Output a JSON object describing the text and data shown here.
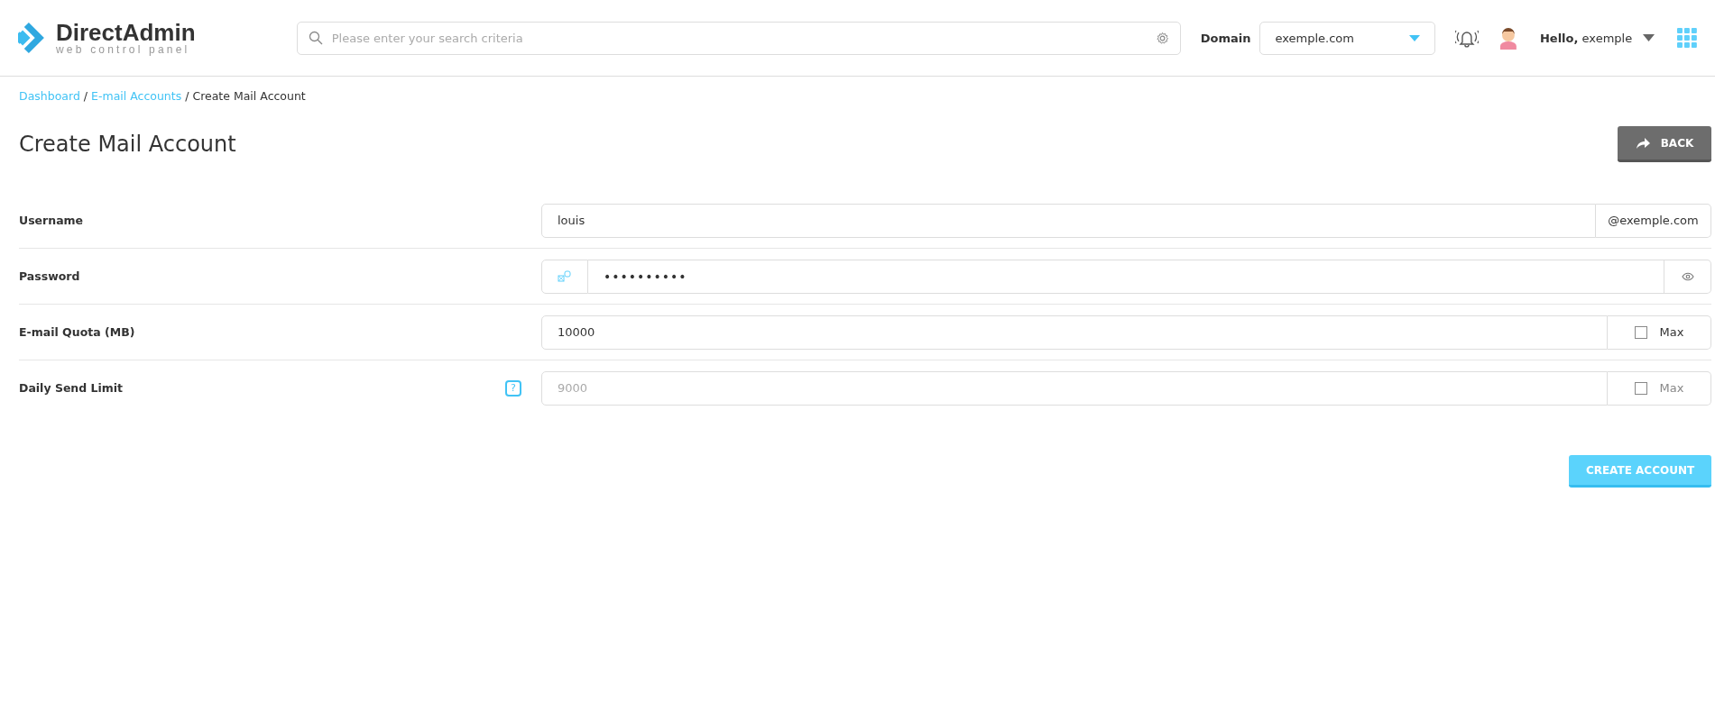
{
  "header": {
    "logo": {
      "name": "DirectAdmin",
      "tagline": "web control panel"
    },
    "search": {
      "placeholder": "Please enter your search criteria"
    },
    "domain": {
      "label": "Domain",
      "value": "exemple.com"
    },
    "user": {
      "greeting": "Hello,",
      "name": "exemple"
    }
  },
  "breadcrumb": [
    {
      "label": "Dashboard",
      "kind": "link"
    },
    {
      "label": "/",
      "kind": "separator"
    },
    {
      "label": "E-mail Accounts",
      "kind": "link"
    },
    {
      "label": "/",
      "kind": "separator"
    },
    {
      "label": "Create Mail Account",
      "kind": "current"
    }
  ],
  "page": {
    "title": "Create Mail Account",
    "back_button": "BACK"
  },
  "form": [
    {
      "kind": "suffix",
      "label": "Username",
      "value": "louis",
      "suffix": "@exemple.com"
    },
    {
      "kind": "password",
      "label": "Password",
      "value": "••••••••••"
    },
    {
      "kind": "max",
      "label": "E-mail Quota (MB)",
      "value": "10000",
      "max": {
        "label": "Max",
        "checked": false,
        "disabled": false
      }
    },
    {
      "kind": "max",
      "label": "Daily Send Limit",
      "help": "?",
      "placeholder": "9000",
      "max": {
        "label": "Max",
        "checked": false,
        "disabled": true
      }
    }
  ],
  "submit_button": "CREATE ACCOUNT"
}
